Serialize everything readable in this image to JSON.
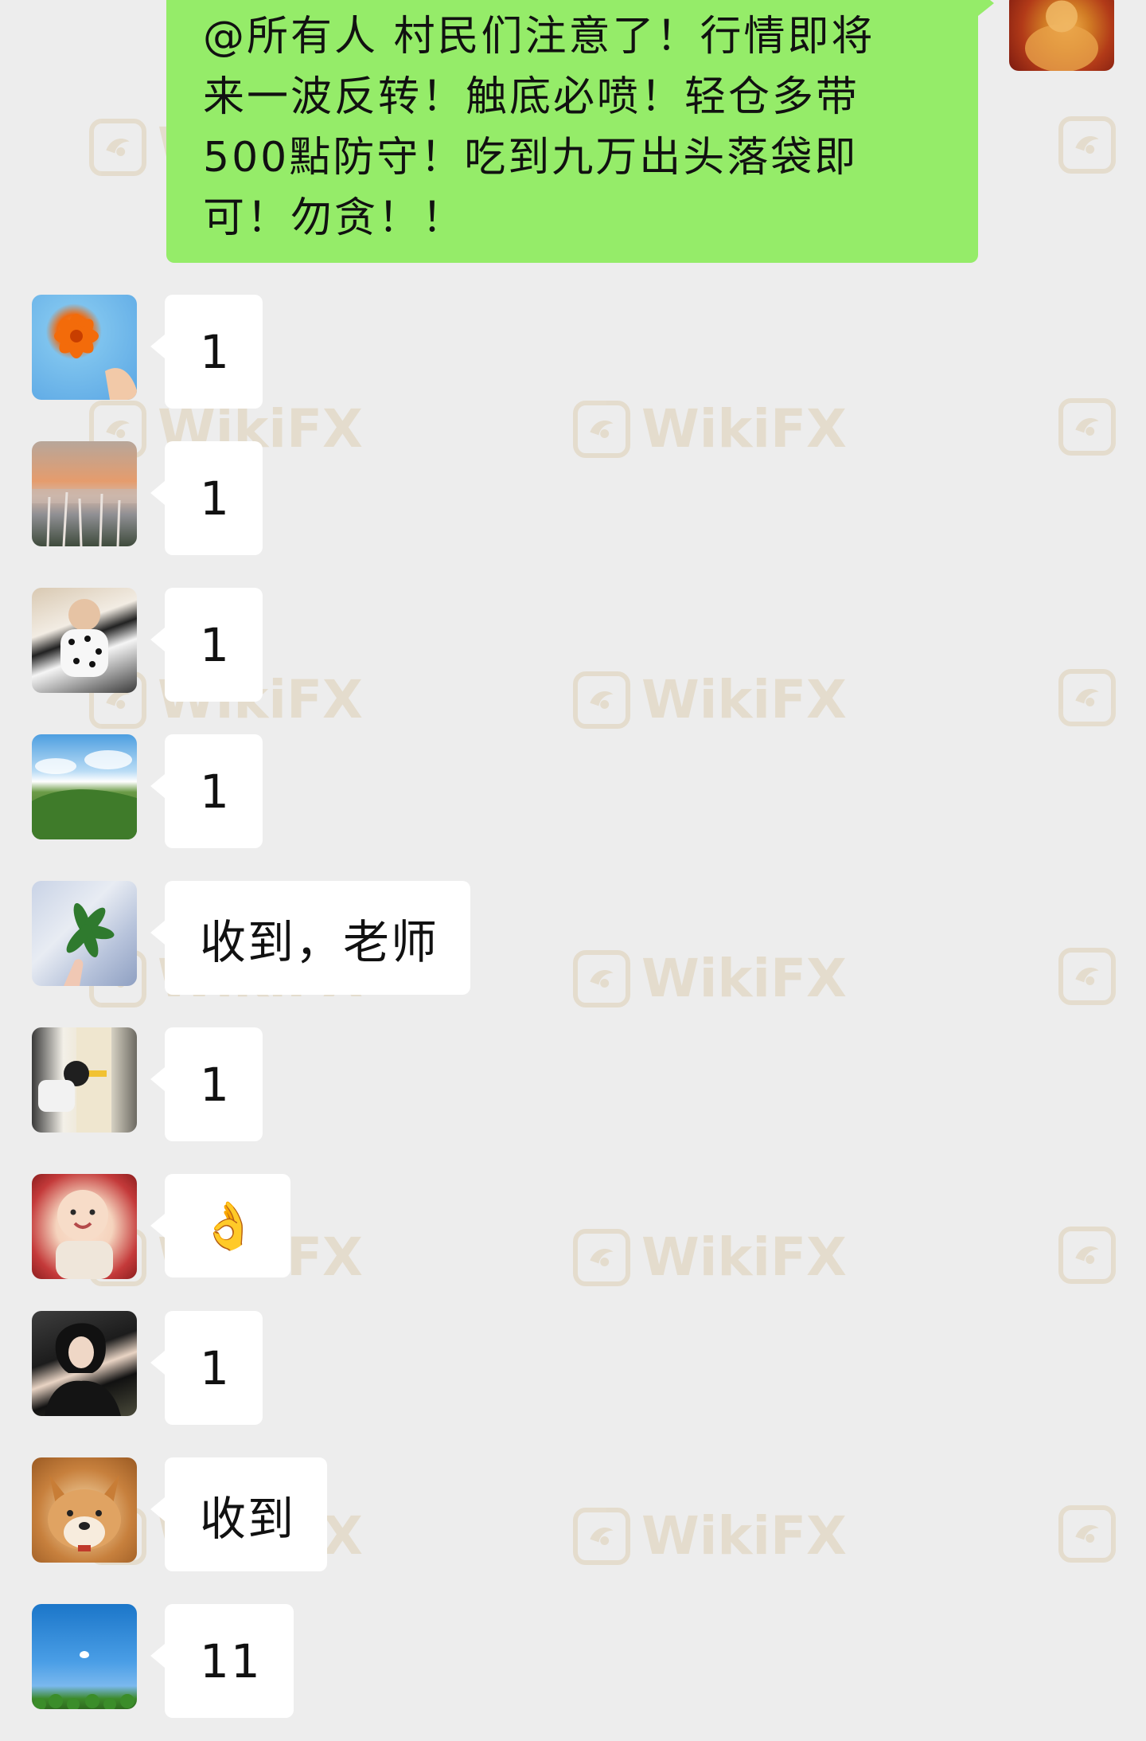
{
  "watermark": {
    "text": "WikiFX"
  },
  "outgoing": {
    "lines": [
      "@所有人 村民们注意了！行情即将",
      "来一波反转！触底必喷！轻仓多带",
      "500點防守！吃到九万出头落袋即",
      "可！勿贪！！"
    ],
    "bubble_color": "#95ec69"
  },
  "messages": [
    {
      "text": "1"
    },
    {
      "text": "1"
    },
    {
      "text": "1"
    },
    {
      "text": "1"
    },
    {
      "text": "收到，老师"
    },
    {
      "text": "1"
    },
    {
      "text": "👌"
    },
    {
      "text": "1"
    },
    {
      "text": "收到"
    },
    {
      "text": "11"
    }
  ],
  "colors": {
    "background": "#ededed",
    "incoming_bubble": "#ffffff"
  }
}
